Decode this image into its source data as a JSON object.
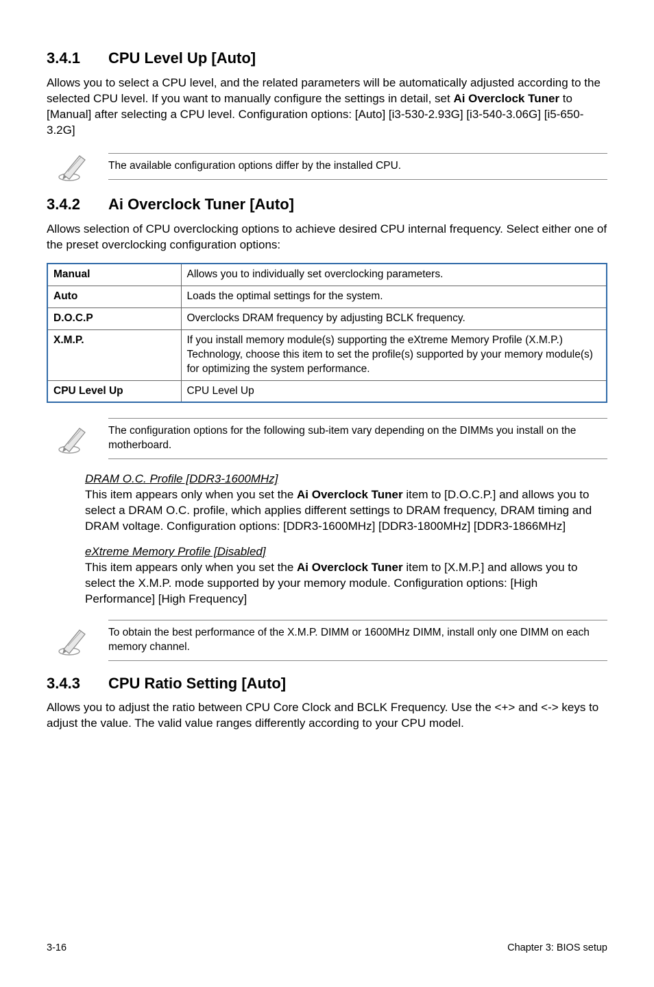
{
  "s341": {
    "num": "3.4.1",
    "title": "CPU Level Up [Auto]",
    "body": "Allows you to select a CPU level, and the related parameters will be automatically adjusted according to the selected CPU level. If you want to manually configure the settings in detail, set Ai Overclock Tuner to [Manual] after selecting a CPU level. Configuration options: [Auto] [i3-530-2.93G] [i3-540-3.06G] [i5-650-3.2G]",
    "note": "The available configuration options differ by the installed CPU."
  },
  "s342": {
    "num": "3.4.2",
    "title": "Ai Overclock Tuner [Auto]",
    "body": "Allows selection of CPU overclocking options to achieve desired CPU internal frequency. Select either one of the preset overclocking configuration options:",
    "rows": [
      {
        "k": "Manual",
        "v": "Allows you to individually set overclocking parameters."
      },
      {
        "k": "Auto",
        "v": "Loads the optimal settings for the system."
      },
      {
        "k": "D.O.C.P",
        "v": "Overclocks DRAM frequency by adjusting BCLK frequency."
      },
      {
        "k": "X.M.P.",
        "v": "If you install memory module(s) supporting the eXtreme Memory Profile (X.M.P.) Technology, choose this item to set the profile(s) supported by your memory module(s) for optimizing the system performance."
      },
      {
        "k": "CPU Level Up",
        "v": "CPU Level Up"
      }
    ],
    "note1": "The configuration options for the following sub-item vary depending on the DIMMs you install on the motherboard.",
    "sub1_head": "DRAM O.C. Profile [DDR3-1600MHz]",
    "sub1_body": "This item appears only when you set the Ai Overclock Tuner item to [D.O.C.P.] and allows you to select a DRAM O.C. profile, which applies different settings to DRAM frequency, DRAM timing and DRAM voltage. Configuration options: [DDR3-1600MHz] [DDR3-1800MHz] [DDR3-1866MHz]",
    "sub2_head": "eXtreme Memory Profile [Disabled]",
    "sub2_body": "This item appears only when you set the Ai Overclock Tuner item to [X.M.P.] and allows you to select the X.M.P. mode supported by your memory module. Configuration options: [High Performance] [High Frequency]",
    "note2": "To obtain the best performance of the X.M.P. DIMM or 1600MHz DIMM, install only one DIMM on each memory channel."
  },
  "s343": {
    "num": "3.4.3",
    "title": "CPU Ratio Setting [Auto]",
    "body": "Allows you to adjust the ratio between CPU Core Clock and BCLK Frequency. Use the <+> and <-> keys to adjust the value. The valid value ranges differently according to your CPU model."
  },
  "footer": {
    "left": "3-16",
    "right": "Chapter 3: BIOS setup"
  }
}
